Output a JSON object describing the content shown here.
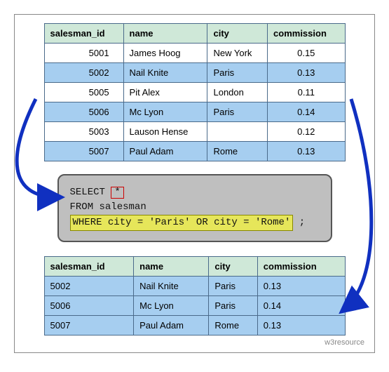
{
  "headers": {
    "salesman_id": "salesman_id",
    "name": "name",
    "city": "city",
    "commission": "commission"
  },
  "source_rows": [
    {
      "id": "5001",
      "name": "James Hoog",
      "city": "New York",
      "commission": "0.15",
      "hl": false
    },
    {
      "id": "5002",
      "name": "Nail Knite",
      "city": "Paris",
      "commission": "0.13",
      "hl": true
    },
    {
      "id": "5005",
      "name": "Pit Alex",
      "city": "London",
      "commission": "0.11",
      "hl": false
    },
    {
      "id": "5006",
      "name": "Mc Lyon",
      "city": "Paris",
      "commission": "0.14",
      "hl": true
    },
    {
      "id": "5003",
      "name": "Lauson Hense",
      "city": "",
      "commission": "0.12",
      "hl": false
    },
    {
      "id": "5007",
      "name": "Paul Adam",
      "city": "Rome",
      "commission": "0.13",
      "hl": true
    }
  ],
  "result_rows": [
    {
      "id": "5002",
      "name": "Nail Knite",
      "city": "Paris",
      "commission": "0.13"
    },
    {
      "id": "5006",
      "name": "Mc Lyon",
      "city": "Paris",
      "commission": "0.14"
    },
    {
      "id": "5007",
      "name": "Paul Adam",
      "city": "Rome",
      "commission": "0.13"
    }
  ],
  "sql": {
    "select": "SELECT",
    "star": "*",
    "from": "FROM salesman",
    "where": "WHERE city = 'Paris' OR city = 'Rome'",
    "semi": ";"
  },
  "watermark": "w3resource"
}
